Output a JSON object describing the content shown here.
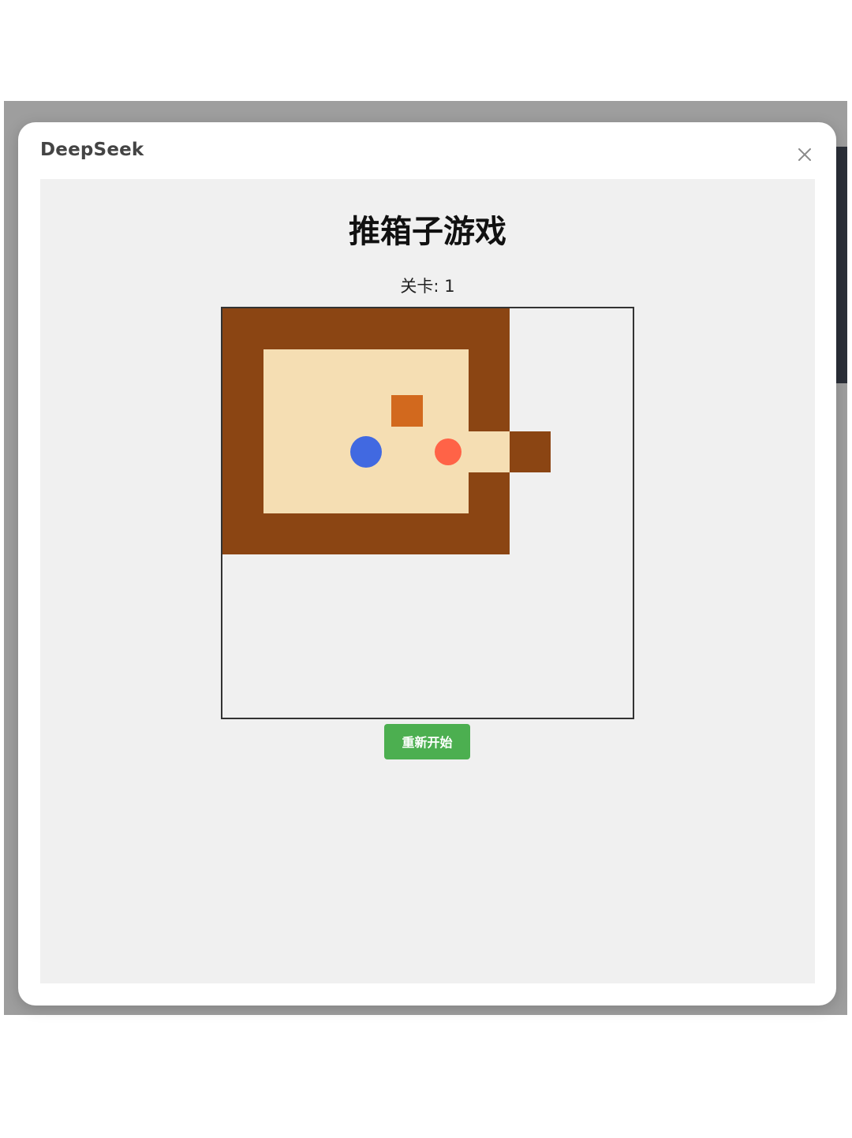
{
  "dialog": {
    "title": "DeepSeek",
    "close_icon": "close-icon"
  },
  "game": {
    "title": "推箱子游戏",
    "level_label": "关卡",
    "level_value": "1",
    "restart_label": "重新开始",
    "grid": {
      "rows": 10,
      "cols": 10,
      "cells": [
        "WWWWWWW...",
        "W     W...",
        "W   B W...",
        "W  G P W..",
        "W     W...",
        "WWWWWWW...",
        "..........",
        "..........",
        "..........",
        ".........."
      ],
      "legend": {
        "W": "wall",
        " ": "floor",
        "B": "box",
        "G": "goal",
        "P": "player",
        ".": "empty"
      }
    },
    "colors": {
      "wall": "#8b4513",
      "floor": "#f5deb3",
      "box": "#d2691e",
      "goal": "#4169e1",
      "player": "#ff6347",
      "empty": "#f0f0f0",
      "restart_button": "#4caf50"
    }
  }
}
